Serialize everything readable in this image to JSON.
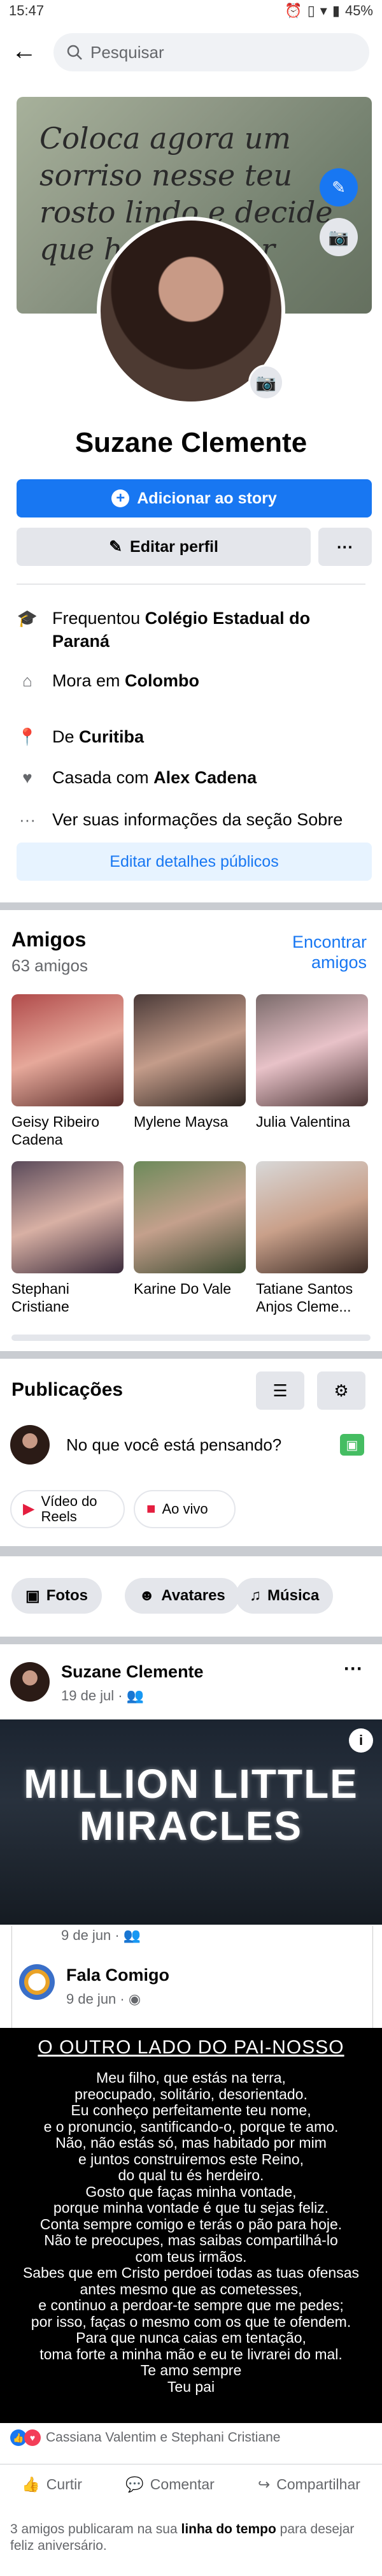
{
  "status_bar": {
    "time": "15:47",
    "battery": "45%",
    "icons": [
      "alarm-icon",
      "vibrate-icon",
      "wifi-icon",
      "battery-icon"
    ]
  },
  "search": {
    "placeholder": "Pesquisar"
  },
  "cover": {
    "text": "Coloca agora um sorriso nesse teu rosto lindo e decide que hoje vai ser"
  },
  "profile": {
    "name": "Suzane Clemente"
  },
  "buttons": {
    "add_story": "Adicionar ao story",
    "edit_profile": "Editar perfil",
    "more": "···",
    "edit_public_details": "Editar detalhes públicos"
  },
  "about": {
    "studied_prefix": "Frequentou ",
    "studied_school": "Colégio Estadual do Paraná",
    "lives_prefix": "Mora em ",
    "lives_city": "Colombo",
    "from_prefix": "De ",
    "from_city": "Curitiba",
    "relationship_prefix": "Casada com ",
    "relationship_partner": "Alex Cadena",
    "see_more": "Ver suas informações da seção Sobre"
  },
  "friends": {
    "title": "Amigos",
    "count": "63 amigos",
    "find": "Encontrar amigos",
    "items": [
      {
        "name": "Geisy Ribeiro Cadena"
      },
      {
        "name": "Mylene Maysa"
      },
      {
        "name": "Julia Valentina"
      },
      {
        "name": "Stephani Cristiane"
      },
      {
        "name": "Karine Do Vale"
      },
      {
        "name": "Tatiane Santos Anjos Cleme..."
      }
    ]
  },
  "publications": {
    "title": "Publicações",
    "compose_prompt": "No que você está pensando?",
    "reels_label": "Vídeo do Reels",
    "live_label": "Ao vivo",
    "chips": [
      "Fotos",
      "Avatares",
      "Música"
    ]
  },
  "post": {
    "author": "Suzane Clemente",
    "date": "19 de jul · ",
    "more": "···",
    "video_title": "MILLION LITTLE MIRACLES",
    "shared_peek_date": "9 de jun · ",
    "shared_author": "Fala Comigo",
    "shared_date": "9 de jun · ",
    "prayer_title": "O OUTRO LADO DO PAI-NOSSO",
    "prayer_lines": [
      "Meu filho, que estás na terra,",
      "preocupado, solitário, desorientado.",
      "Eu conheço perfeitamente teu nome,",
      "e o pronuncio, santificando-o, porque te amo.",
      "Não, não estás só, mas habitado por mim",
      "e juntos construiremos este Reino,",
      "do qual tu és herdeiro.",
      "Gosto que faças minha vontade,",
      "porque minha vontade é que tu sejas feliz.",
      "Conta sempre comigo e terás o pão para hoje.",
      "Não te preocupes, mas saibas compartilhá-lo",
      "com teus irmãos.",
      "Sabes que em Cristo perdoei todas as tuas ofensas",
      "antes mesmo que as cometesses,",
      "e continuo a perdoar-te sempre que me pedes;",
      "por isso, faças o mesmo com os que te ofendem.",
      "Para que nunca caias em tentação,",
      "toma forte a minha mão e eu te livrarei do mal.",
      "Te amo sempre",
      "Teu pai"
    ],
    "reactions_text": "Cassiana Valentim e Stephani Cristiane",
    "actions": [
      "Curtir",
      "Comentar",
      "Compartilhar"
    ]
  },
  "footer": {
    "prefix": "3 amigos publicaram na sua ",
    "bold": "linha do tempo",
    "suffix": " para desejar feliz aniversário."
  }
}
